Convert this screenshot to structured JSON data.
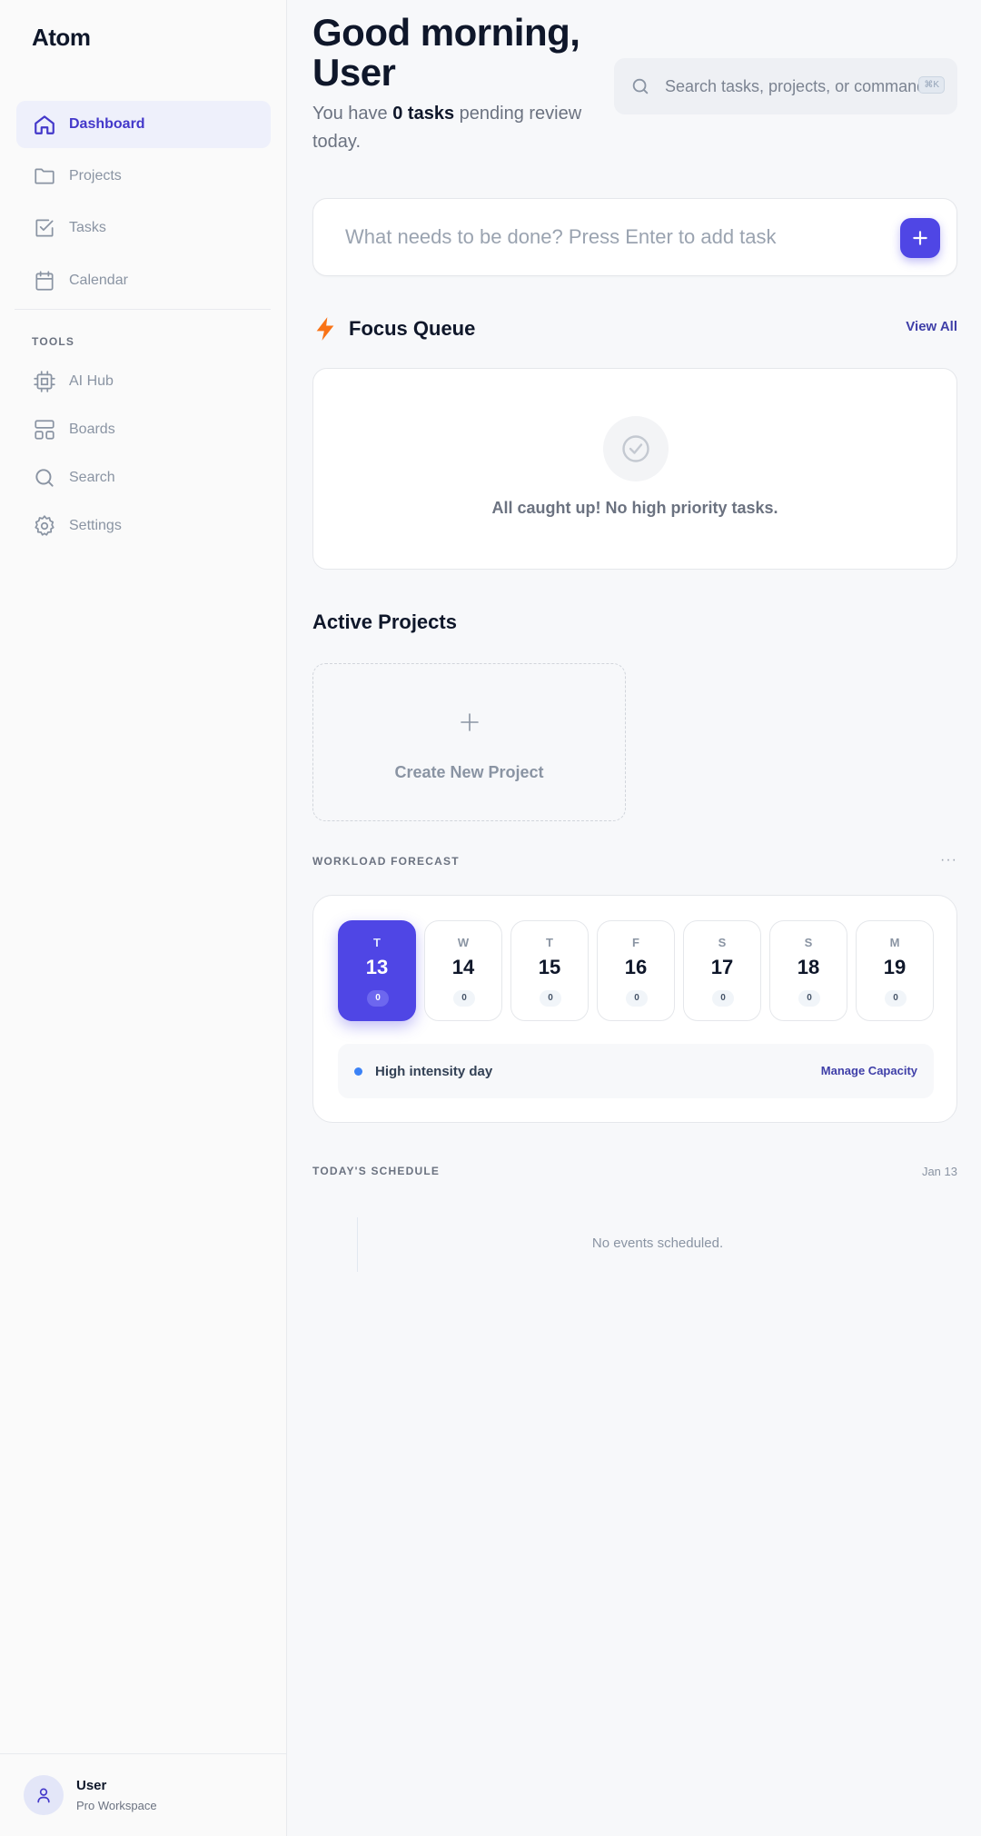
{
  "app": {
    "brand": "Atom"
  },
  "sidebar": {
    "items": [
      {
        "label": "Dashboard",
        "icon": "home-icon",
        "active": true
      },
      {
        "label": "Projects",
        "icon": "folder-icon"
      },
      {
        "label": "Tasks",
        "icon": "checkbox-icon"
      },
      {
        "label": "Calendar",
        "icon": "calendar-icon"
      }
    ],
    "tools_label": "TOOLS",
    "tools": [
      {
        "label": "AI Hub",
        "icon": "cpu-icon"
      },
      {
        "label": "Boards",
        "icon": "layout-icon"
      },
      {
        "label": "Search",
        "icon": "search-icon"
      },
      {
        "label": "Settings",
        "icon": "gear-icon"
      }
    ],
    "user": {
      "name": "User",
      "workspace": "Pro Workspace"
    }
  },
  "header": {
    "greeting": "Good morning, User",
    "sub_prefix": "You have ",
    "sub_count": "0 tasks",
    "sub_suffix": " pending review today.",
    "search_placeholder": "Search tasks, projects, or commands...",
    "shortcut": "⌘K"
  },
  "task_input": {
    "placeholder": "What needs to be done? Press Enter to add task"
  },
  "focus_queue": {
    "title": "Focus Queue",
    "view_all": "View All",
    "empty_text": "All caught up! No high priority tasks."
  },
  "active_projects": {
    "title": "Active Projects",
    "create_label": "Create New Project"
  },
  "workload": {
    "label": "WORKLOAD FORECAST",
    "more": "···",
    "days": [
      {
        "letter": "T",
        "num": "13",
        "count": "0",
        "active": true
      },
      {
        "letter": "W",
        "num": "14",
        "count": "0"
      },
      {
        "letter": "T",
        "num": "15",
        "count": "0"
      },
      {
        "letter": "F",
        "num": "16",
        "count": "0"
      },
      {
        "letter": "S",
        "num": "17",
        "count": "0"
      },
      {
        "letter": "S",
        "num": "18",
        "count": "0"
      },
      {
        "letter": "M",
        "num": "19",
        "count": "0"
      }
    ],
    "legend": "High intensity day",
    "manage": "Manage Capacity"
  },
  "schedule": {
    "label": "TODAY'S SCHEDULE",
    "date": "Jan 13",
    "empty": "No events scheduled."
  },
  "colors": {
    "accent": "#4f46e5",
    "bolt": "#f97316",
    "legend_dot": "#3b82f6"
  }
}
